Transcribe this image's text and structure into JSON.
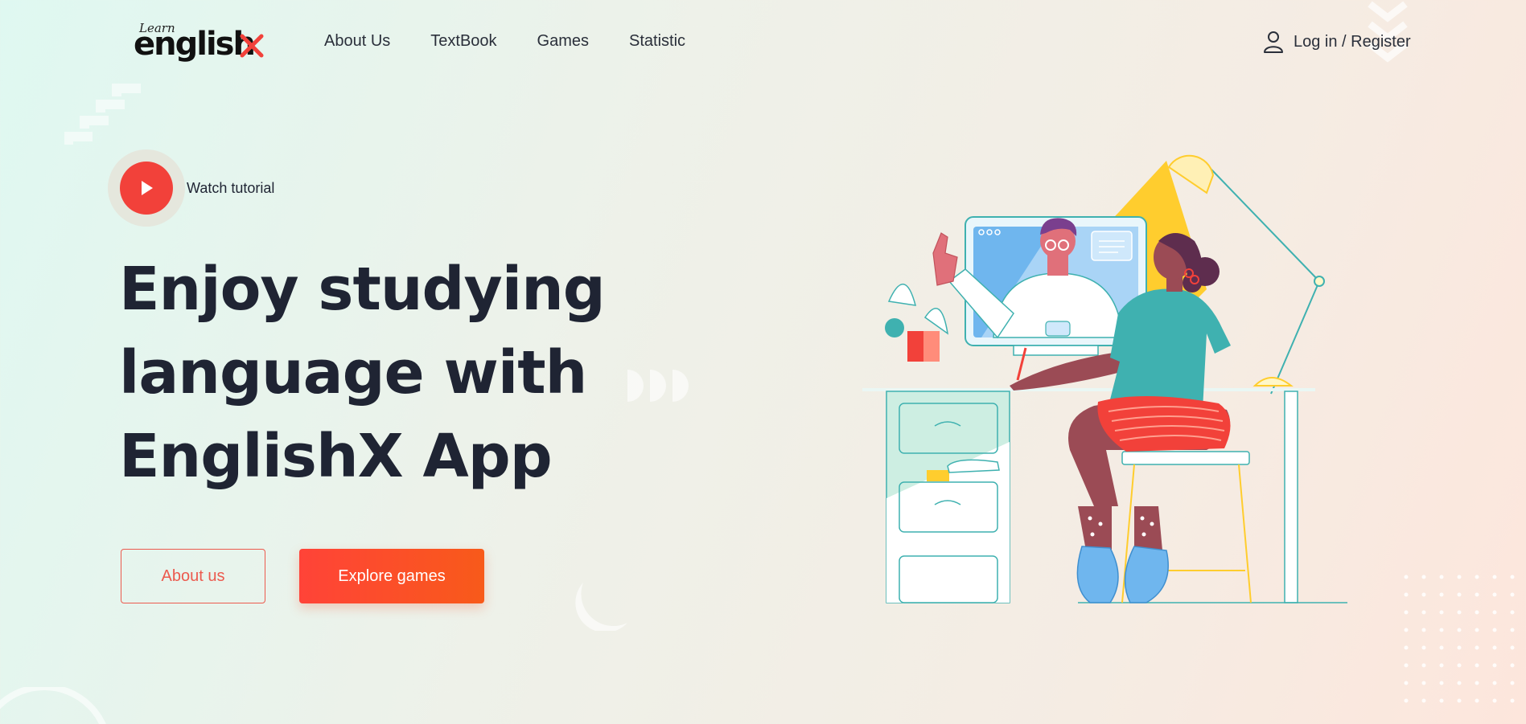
{
  "header": {
    "logo": {
      "small": "Learn",
      "main": "english"
    },
    "nav": [
      {
        "label": "About Us"
      },
      {
        "label": "TextBook"
      },
      {
        "label": "Games"
      },
      {
        "label": "Statistic"
      }
    ],
    "login_label": "Log in / Register",
    "login_icon": "user-icon"
  },
  "hero": {
    "watch_label": "Watch tutorial",
    "watch_icon": "play-icon",
    "title_lines": [
      "Enjoy studying",
      "language with",
      "EnglishX App"
    ],
    "buttons": {
      "about": "About us",
      "explore": "Explore games"
    }
  },
  "colors": {
    "accent": "#f2413a",
    "accent_orange": "#f85a1a",
    "text_dark": "#1f2433",
    "teal": "#3fb1b0",
    "yellow": "#ffcd2e"
  }
}
